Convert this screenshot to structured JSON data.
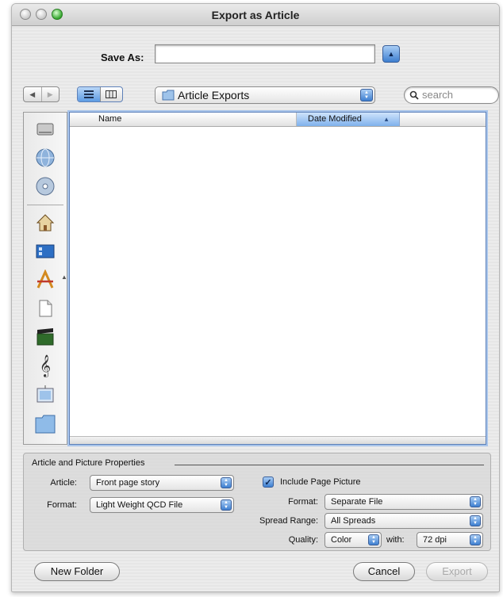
{
  "window": {
    "title": "Export as Article"
  },
  "save_as": {
    "label": "Save As:",
    "value": ""
  },
  "location": {
    "current": "Article Exports"
  },
  "search": {
    "placeholder": "search"
  },
  "file_list": {
    "columns": [
      "Name",
      "Date Modified"
    ],
    "sort_column": "Date Modified",
    "rows": []
  },
  "sidebar": {
    "items": [
      {
        "icon": "hard-disk-icon"
      },
      {
        "icon": "network-icon"
      },
      {
        "icon": "disc-icon"
      },
      {
        "icon": "home-icon"
      },
      {
        "icon": "desktop-icon"
      },
      {
        "icon": "applications-icon"
      },
      {
        "icon": "documents-icon"
      },
      {
        "icon": "movies-icon"
      },
      {
        "icon": "music-icon"
      },
      {
        "icon": "pictures-icon"
      },
      {
        "icon": "folder-icon"
      }
    ]
  },
  "properties": {
    "title": "Article and Picture Properties",
    "article_label": "Article:",
    "article_value": "Front page story",
    "format_label": "Format:",
    "format_value": "Light Weight QCD File",
    "include_picture_label": "Include Page Picture",
    "include_picture_checked": true,
    "picture_format_label": "Format:",
    "picture_format_value": "Separate File",
    "spread_range_label": "Spread Range:",
    "spread_range_value": "All Spreads",
    "quality_label": "Quality:",
    "quality_value": "Color",
    "with_label": "with:",
    "dpi_value": "72 dpi"
  },
  "buttons": {
    "new_folder": "New Folder",
    "cancel": "Cancel",
    "export": "Export"
  },
  "colors": {
    "accent": "#3e7fd0",
    "selection": "#a9c5eb"
  }
}
